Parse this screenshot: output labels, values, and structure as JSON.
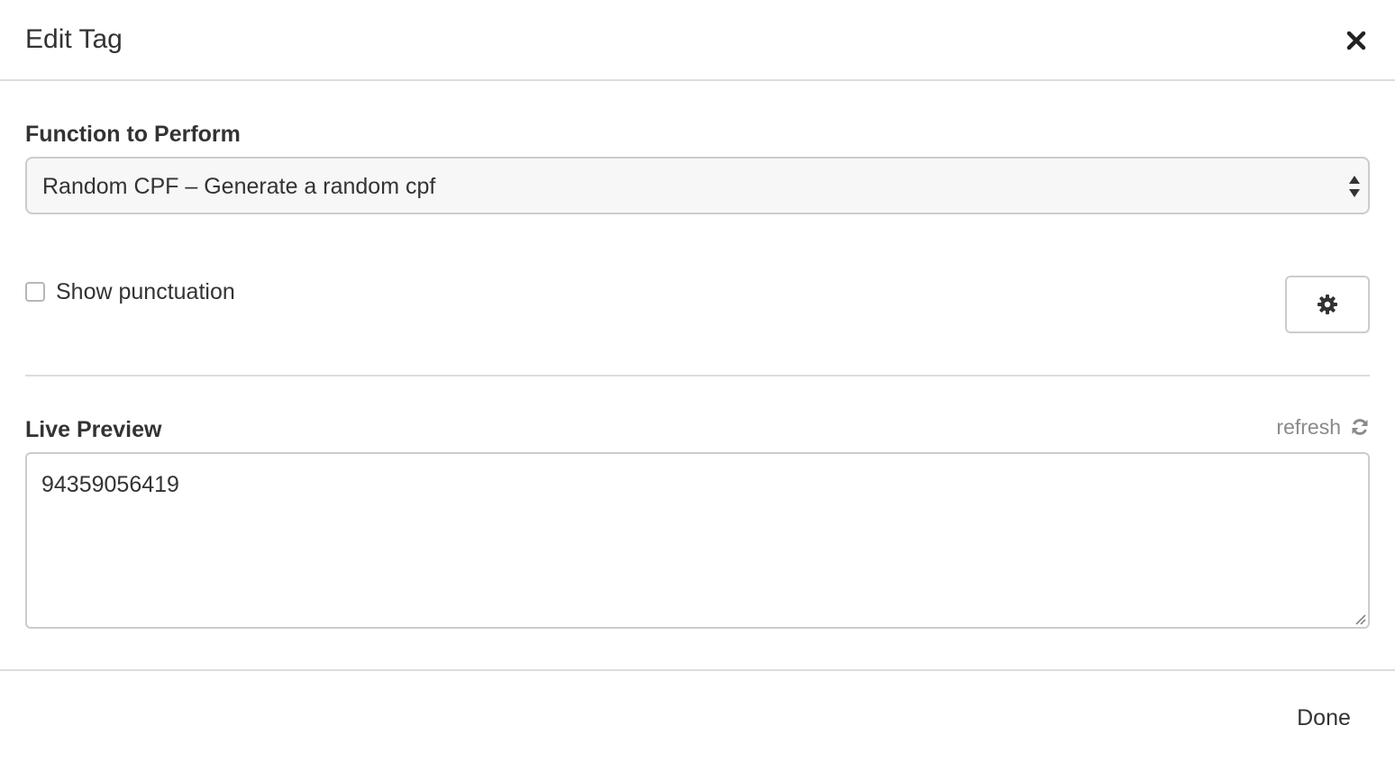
{
  "dialog": {
    "title": "Edit Tag",
    "close_icon": "close-icon"
  },
  "function_field": {
    "label": "Function to Perform",
    "selected_value": "Random CPF – Generate a random cpf",
    "arrows_icon": "select-arrows-icon"
  },
  "options": {
    "show_punctuation_label": "Show punctuation",
    "show_punctuation_checked": false,
    "settings_icon": "gear-icon"
  },
  "preview": {
    "label": "Live Preview",
    "refresh_label": "refresh",
    "refresh_icon": "refresh-icon",
    "value": "94359056419"
  },
  "footer": {
    "done_label": "Done"
  }
}
